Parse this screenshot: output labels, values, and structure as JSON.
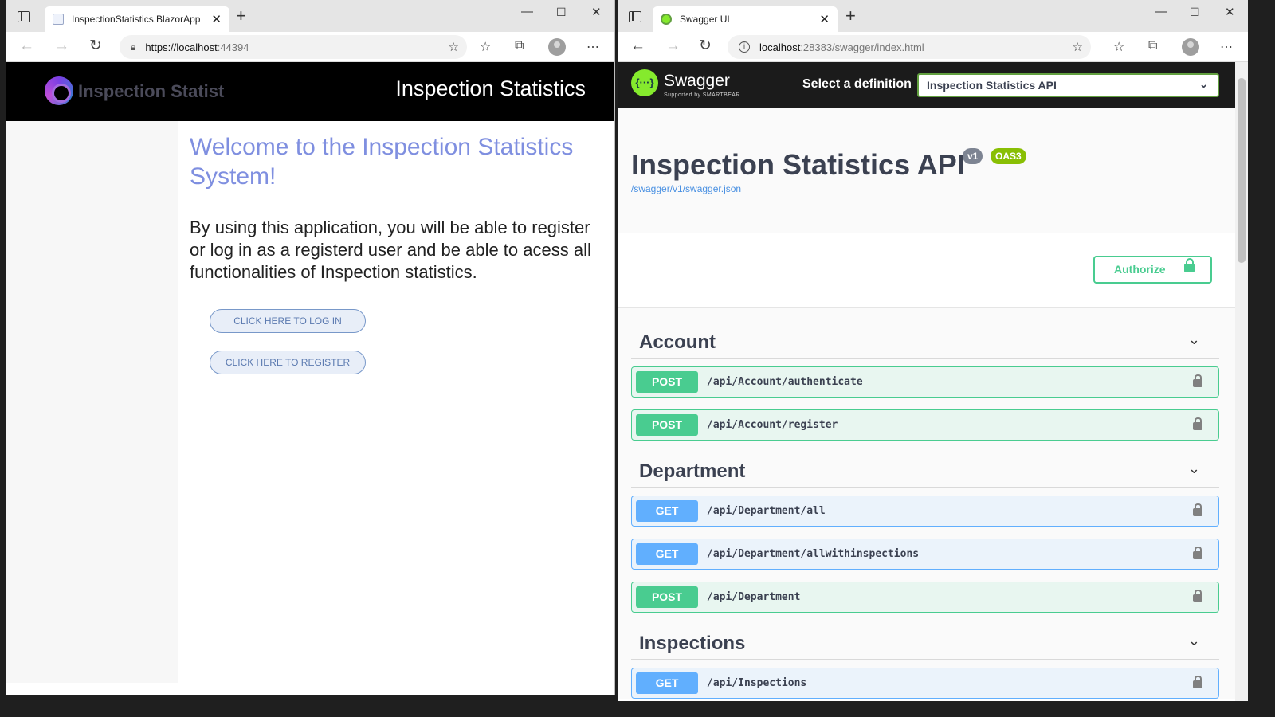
{
  "left": {
    "tab_title": "InspectionStatistics.BlazorApp",
    "url_host": "https://localhost",
    "url_rest": ":44394",
    "logo_text": "Inspection Statist",
    "header_title": "Inspection Statistics",
    "welcome": "Welcome to the Inspection Statistics System!",
    "intro": "By using this application, you will be able to register or log in as a registerd user and be able to acess all functionalities of Inspection statistics.",
    "login_button": "CLICK HERE TO LOG IN",
    "register_button": "CLICK HERE TO REGISTER"
  },
  "right": {
    "tab_title": "Swagger UI",
    "url_host": "localhost",
    "url_rest": ":28383/swagger/index.html",
    "brand": "Swagger",
    "brand_sub": "Supported by SMARTBEAR",
    "definition_label": "Select a definition",
    "definition_value": "Inspection Statistics API",
    "api_title": "Inspection Statistics API",
    "version_badge": "v1",
    "oas_badge": "OAS3",
    "spec_link": "/swagger/v1/swagger.json",
    "authorize": "Authorize",
    "tags": [
      {
        "name": "Account",
        "ops": [
          {
            "method": "POST",
            "path": "/api/Account/authenticate"
          },
          {
            "method": "POST",
            "path": "/api/Account/register"
          }
        ]
      },
      {
        "name": "Department",
        "ops": [
          {
            "method": "GET",
            "path": "/api/Department/all"
          },
          {
            "method": "GET",
            "path": "/api/Department/allwithinspections"
          },
          {
            "method": "POST",
            "path": "/api/Department"
          }
        ]
      },
      {
        "name": "Inspections",
        "ops": [
          {
            "method": "GET",
            "path": "/api/Inspections"
          }
        ]
      }
    ]
  },
  "colors": {
    "post": "#49cc90",
    "get": "#61affe",
    "swagger_green": "#85ea2d",
    "welcome_text": "#7f8fe0"
  }
}
